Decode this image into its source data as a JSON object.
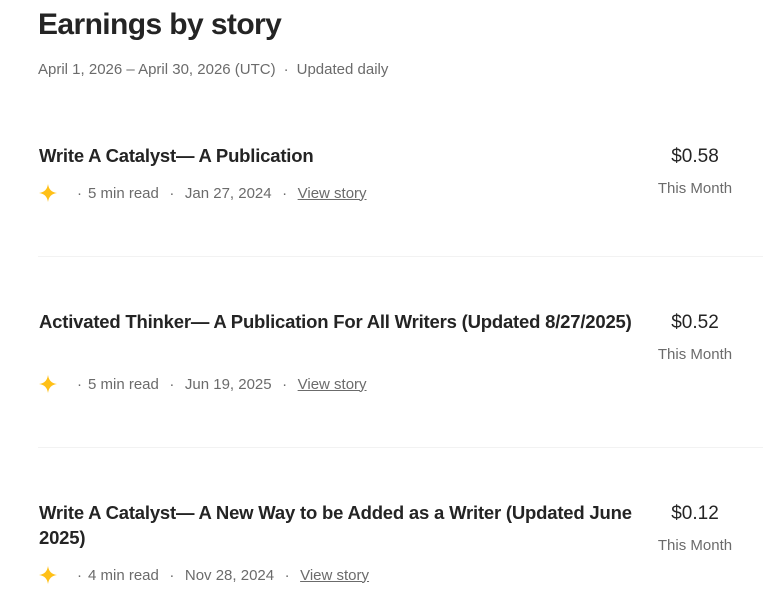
{
  "header": {
    "title": "Earnings by story",
    "date_range": "April 1, 2026 – April 30, 2026 (UTC)",
    "separator": "·",
    "update_note": "Updated daily"
  },
  "stories": [
    {
      "title": "Write A Catalyst— A Publication",
      "read_time": "5 min read",
      "date": "Jan 27, 2024",
      "link_label": "View story",
      "amount": "$0.58",
      "period": "This Month"
    },
    {
      "title": "Activated Thinker— A Publication For All Writers (Updated 8/27/2025)",
      "read_time": "5 min read",
      "date": "Jun 19, 2025",
      "link_label": "View story",
      "amount": "$0.52",
      "period": "This Month"
    },
    {
      "title": "Write A Catalyst— A New Way to be Added as a Writer (Updated June 2025)",
      "read_time": "4 min read",
      "date": "Nov 28, 2024",
      "link_label": "View story",
      "amount": "$0.12",
      "period": "This Month"
    }
  ],
  "icons": {
    "member_only": "star-icon"
  },
  "colors": {
    "star": "#FFC017",
    "text_primary": "#242424",
    "text_secondary": "#6B6B6B",
    "divider": "#F2F2F2"
  }
}
